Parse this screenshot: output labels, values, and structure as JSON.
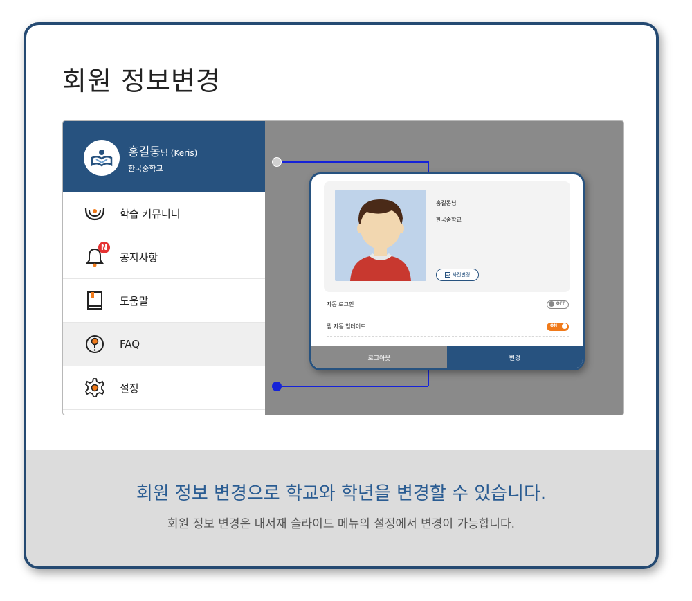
{
  "title": "회원 정보변경",
  "drawer": {
    "user_name": "홍길동",
    "user_suffix": "님 (Keris)",
    "school": "한국중학교",
    "items": [
      {
        "label": "학습 커뮤니티",
        "icon": "community-icon"
      },
      {
        "label": "공지사항",
        "icon": "bell-icon",
        "badge": "N"
      },
      {
        "label": "도움말",
        "icon": "book-icon"
      },
      {
        "label": "FAQ",
        "icon": "question-icon"
      },
      {
        "label": "설정",
        "icon": "gear-icon"
      }
    ]
  },
  "dialog": {
    "name": "홍길동님",
    "school": "한국중학교",
    "photo_button": "사진변경",
    "settings": [
      {
        "label": "자동 로그인",
        "state": "OFF"
      },
      {
        "label": "앱 자동 업데이트",
        "state": "ON"
      }
    ],
    "logout_label": "로그아웃",
    "change_label": "변경"
  },
  "headline": "회원 정보 변경으로 학교와 학년을 변경할 수 있습니다.",
  "subline": "회원 정보 변경은 내서재 슬라이드 메뉴의 설정에서 변경이 가능합니다.",
  "colors": {
    "primary": "#27527f",
    "accent_blue": "#1522d8",
    "toggle_on": "#f07a1a",
    "badge": "#e53232"
  }
}
